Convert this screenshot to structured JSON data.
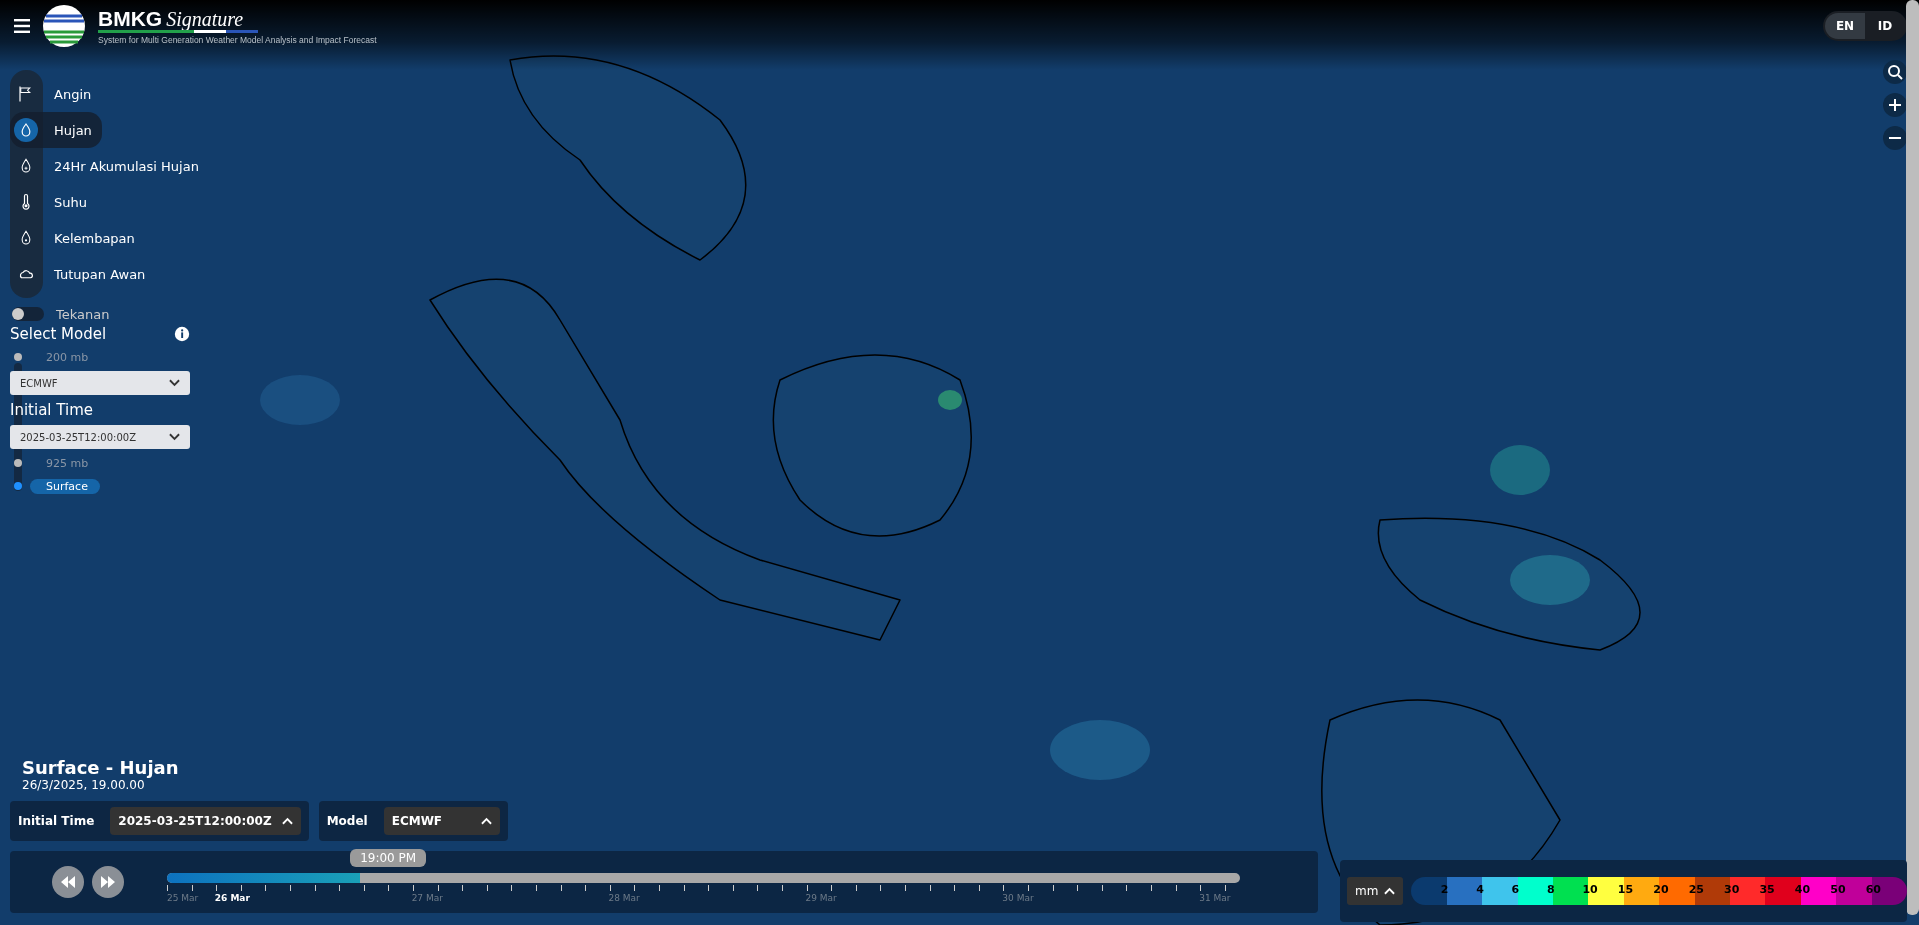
{
  "header": {
    "brand": "BMKG",
    "brand_script": "Signature",
    "subtitle": "System for Multi Generation Weather Model Analysis and Impact Forecast"
  },
  "language_toggle": [
    {
      "label": "EN",
      "selected": true
    },
    {
      "label": "ID",
      "selected": false
    }
  ],
  "layers": [
    {
      "label": "Angin",
      "selected": false
    },
    {
      "label": "Hujan",
      "selected": true
    },
    {
      "label": "24Hr Akumulasi Hujan",
      "selected": false
    },
    {
      "label": "Suhu",
      "selected": false
    },
    {
      "label": "Kelembapan",
      "selected": false
    },
    {
      "label": "Tutupan Awan",
      "selected": false
    }
  ],
  "levels": [
    {
      "kind": "toggle",
      "label": "Tekanan",
      "on": false
    },
    {
      "kind": "level",
      "label": "200 mb",
      "selected": false
    },
    {
      "kind": "level",
      "label": "925 mb",
      "selected": false
    },
    {
      "kind": "level",
      "label": "Surface",
      "selected": true
    }
  ],
  "model_panel": {
    "model_label": "Select Model",
    "model_value": "ECMWF",
    "time_label": "Initial Time",
    "time_value": "2025-03-25T12:00:00Z"
  },
  "summary": {
    "title": "Surface - Hujan",
    "datetime": "26/3/2025, 19.00.00"
  },
  "controls": [
    {
      "label": "Initial Time",
      "value": "2025-03-25T12:00:00Z"
    },
    {
      "label": "Model",
      "value": "ECMWF"
    }
  ],
  "timeline": {
    "current": "19:00 PM",
    "level": 0.18,
    "ticks": [
      {
        "label": "25 Mar",
        "selected": false
      },
      {
        "label": "26 Mar",
        "selected": true
      },
      {
        "label": "27 Mar",
        "selected": false
      },
      {
        "label": "28 Mar",
        "selected": false
      },
      {
        "label": "29 Mar",
        "selected": false
      },
      {
        "label": "30 Mar",
        "selected": false
      },
      {
        "label": "31 Mar",
        "selected": false
      }
    ]
  },
  "legend": {
    "unit": "mm",
    "segments": [
      {
        "color": "#0b3a6e"
      },
      {
        "color": "#2870c0",
        "label": "2"
      },
      {
        "color": "#3fc4ec",
        "label": "4"
      },
      {
        "color": "#00ffcc",
        "label": "6"
      },
      {
        "color": "#00e050",
        "label": "8"
      },
      {
        "color": "#ffff40",
        "label": "10"
      },
      {
        "color": "#ffaa10",
        "label": "15"
      },
      {
        "color": "#ff6a00",
        "label": "20"
      },
      {
        "color": "#b03a08",
        "label": "25"
      },
      {
        "color": "#ff2a2a",
        "label": "30"
      },
      {
        "color": "#e0001c",
        "label": "35"
      },
      {
        "color": "#ff00c8",
        "label": "40"
      },
      {
        "color": "#c0009a",
        "label": "50"
      },
      {
        "color": "#7a0078",
        "label": "60"
      }
    ]
  }
}
